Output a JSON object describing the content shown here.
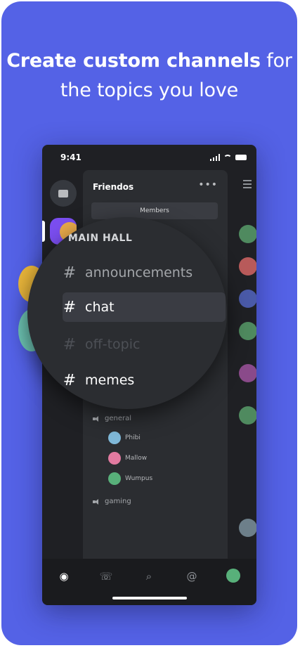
{
  "headline": {
    "bold": "Create custom channels",
    "rest_line1": " for",
    "line2": "the topics you love"
  },
  "status_bar": {
    "time": "9:41"
  },
  "server": {
    "name": "Friendos",
    "more": "•••",
    "members_label": "Members"
  },
  "lens": {
    "category": "MAIN HALL",
    "channels": [
      {
        "name": "announcements",
        "state": "normal"
      },
      {
        "name": "chat",
        "state": "active"
      },
      {
        "name": "off-topic",
        "state": "muted"
      },
      {
        "name": "memes",
        "state": "unread"
      }
    ],
    "hash": "#"
  },
  "voice_channels": [
    {
      "name": "general",
      "users": [
        {
          "name": "Phibi",
          "color": "#7fb8d8"
        },
        {
          "name": "Mallow",
          "color": "#e27aa0"
        },
        {
          "name": "Wumpus",
          "color": "#58b07a"
        }
      ]
    },
    {
      "name": "gaming",
      "users": []
    }
  ],
  "tabs": [
    {
      "name": "home",
      "glyph": "◉"
    },
    {
      "name": "friends",
      "glyph": "☏"
    },
    {
      "name": "search",
      "glyph": "⌕"
    },
    {
      "name": "mentions",
      "glyph": "@"
    },
    {
      "name": "profile",
      "glyph": ""
    }
  ],
  "colors": {
    "background": "#5462e6",
    "phone": "#1f2024",
    "panel": "#2b2d31",
    "accent": "#5865f2"
  }
}
